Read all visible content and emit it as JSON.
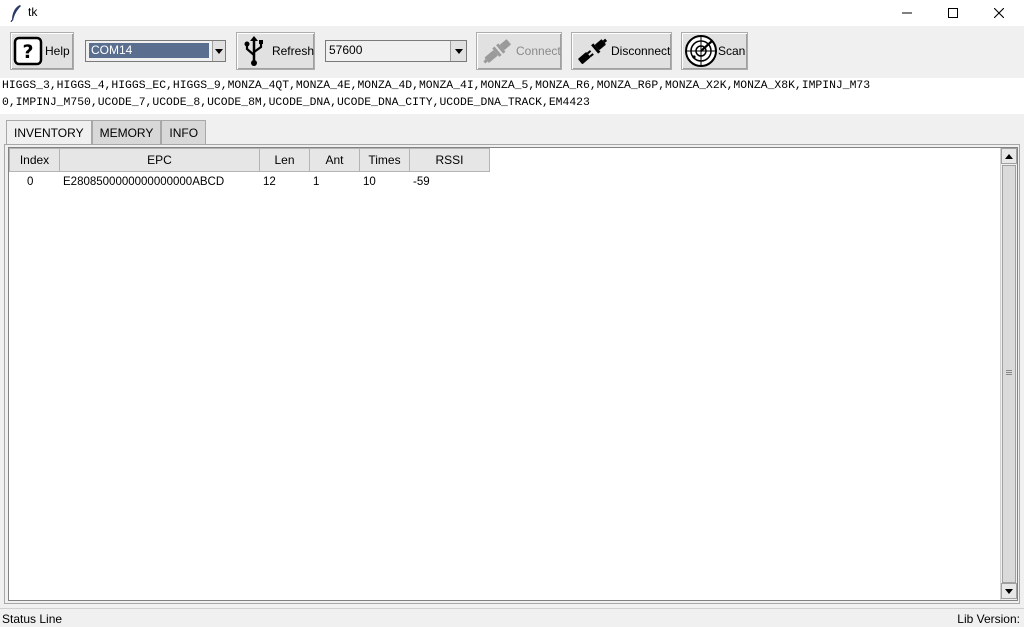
{
  "window": {
    "title": "tk"
  },
  "toolbar": {
    "help_label": "Help",
    "port_value": "COM14",
    "refresh_label": "Refresh",
    "baud_value": "57600",
    "connect_label": "Connect",
    "disconnect_label": "Disconnect",
    "scan_label": "Scan"
  },
  "chips": {
    "line1": "HIGGS_3,HIGGS_4,HIGGS_EC,HIGGS_9,MONZA_4QT,MONZA_4E,MONZA_4D,MONZA_4I,MONZA_5,MONZA_R6,MONZA_R6P,MONZA_X2K,MONZA_X8K,IMPINJ_M73",
    "line2": "0,IMPINJ_M750,UCODE_7,UCODE_8,UCODE_8M,UCODE_DNA,UCODE_DNA_CITY,UCODE_DNA_TRACK,EM4423"
  },
  "tabs": [
    {
      "label": "INVENTORY"
    },
    {
      "label": "MEMORY"
    },
    {
      "label": "INFO"
    }
  ],
  "table": {
    "columns": [
      "Index",
      "EPC",
      "Len",
      "Ant",
      "Times",
      "RSSI"
    ],
    "rows": [
      {
        "index": "0",
        "epc": "E2808500000000000000ABCD",
        "len": "12",
        "ant": "1",
        "times": "10",
        "rssi": "-59"
      }
    ]
  },
  "status": {
    "left": "Status Line",
    "right": "Lib Version:"
  },
  "colors": {
    "selection": "#5a6f8f",
    "background": "#f0f0f0"
  }
}
